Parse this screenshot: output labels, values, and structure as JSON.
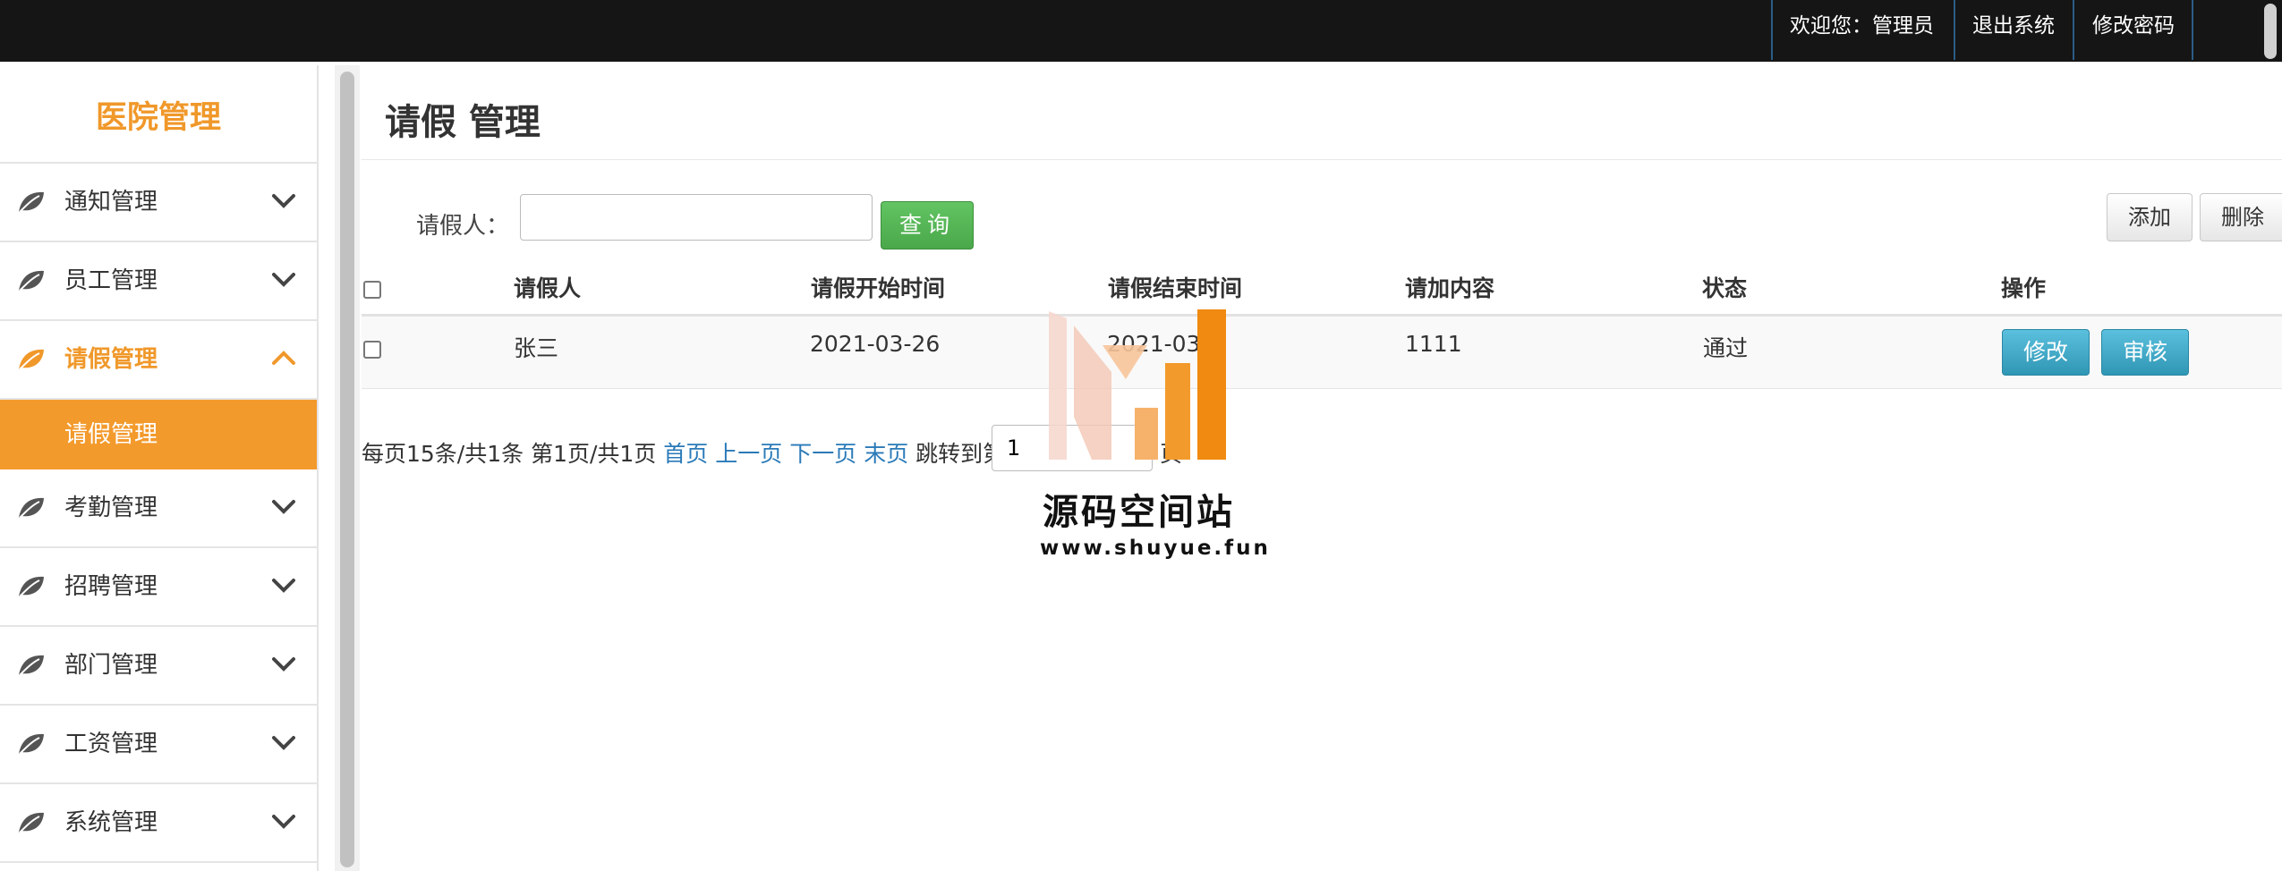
{
  "header": {
    "welcome": "欢迎您：管理员",
    "logout": "退出系统",
    "change_password": "修改密码"
  },
  "sidebar": {
    "brand": "医院管理",
    "items": [
      {
        "label": "通知管理",
        "icon": "leaf-icon",
        "expanded": false
      },
      {
        "label": "员工管理",
        "icon": "leaf-icon",
        "expanded": false
      },
      {
        "label": "请假管理",
        "icon": "leaf-icon",
        "expanded": true,
        "active": true
      },
      {
        "label": "考勤管理",
        "icon": "leaf-icon",
        "expanded": false
      },
      {
        "label": "招聘管理",
        "icon": "leaf-icon",
        "expanded": false
      },
      {
        "label": "部门管理",
        "icon": "leaf-icon",
        "expanded": false
      },
      {
        "label": "工资管理",
        "icon": "leaf-icon",
        "expanded": false
      },
      {
        "label": "系统管理",
        "icon": "leaf-icon",
        "expanded": false
      }
    ],
    "subitem": "请假管理"
  },
  "main": {
    "title": "请假 管理",
    "search": {
      "label": "请假人：",
      "value": "",
      "button": "查询"
    },
    "actions": {
      "add": "添加",
      "delete": "删除"
    },
    "table": {
      "headers": [
        "请假人",
        "请假开始时间",
        "请假结束时间",
        "请加内容",
        "状态",
        "操作"
      ],
      "rows": [
        {
          "name": "张三",
          "start": "2021-03-26",
          "end": "2021-03-2",
          "content": "1111",
          "status": "通过",
          "edit": "修改",
          "review": "审核"
        }
      ]
    },
    "pager": {
      "summary": "每页15条/共1条 第1页/共1页",
      "first": "首页",
      "prev": "上一页",
      "next": "下一页",
      "last": "末页",
      "jump_label": "跳转到第",
      "jump_value": "1",
      "unit": "页"
    }
  },
  "watermark": {
    "name": "源码空间站",
    "url": "www.shuyue.fun"
  },
  "colors": {
    "accent": "#f0982a",
    "topbar": "#151515",
    "search_button": "#4cae4c",
    "info_button": "#3aa4c8",
    "link": "#2a7ab8"
  }
}
